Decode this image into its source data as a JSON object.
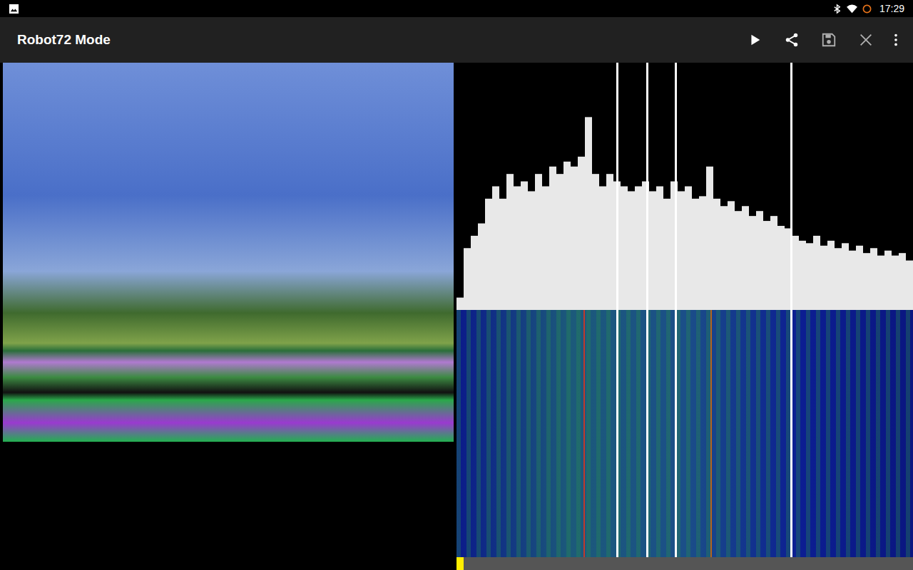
{
  "status_bar": {
    "time": "17:29"
  },
  "app_bar": {
    "title": "Robot72 Mode",
    "actions": [
      {
        "kind": "play",
        "disabled": false
      },
      {
        "kind": "share",
        "disabled": false
      },
      {
        "kind": "save",
        "disabled": true
      },
      {
        "kind": "close",
        "disabled": true
      },
      {
        "kind": "more",
        "disabled": false
      }
    ]
  },
  "spectrum": {
    "bins": 64,
    "values": [
      0.05,
      0.25,
      0.3,
      0.35,
      0.45,
      0.5,
      0.45,
      0.55,
      0.5,
      0.52,
      0.48,
      0.55,
      0.5,
      0.58,
      0.55,
      0.6,
      0.58,
      0.62,
      0.78,
      0.55,
      0.5,
      0.55,
      0.52,
      0.5,
      0.48,
      0.5,
      0.52,
      0.48,
      0.5,
      0.45,
      0.52,
      0.48,
      0.5,
      0.45,
      0.46,
      0.58,
      0.45,
      0.42,
      0.44,
      0.4,
      0.42,
      0.38,
      0.4,
      0.36,
      0.38,
      0.34,
      0.33,
      0.3,
      0.28,
      0.27,
      0.3,
      0.26,
      0.28,
      0.25,
      0.27,
      0.24,
      0.26,
      0.23,
      0.25,
      0.22,
      0.24,
      0.22,
      0.23,
      0.2
    ],
    "markers": [
      22.4,
      26.6,
      30.6,
      46.8
    ]
  },
  "waterfall": {
    "traces": [
      {
        "bin": 17.8,
        "color": "#c0392b"
      },
      {
        "bin": 35.6,
        "color": "#b5651d"
      }
    ]
  },
  "progress": {
    "level": 0.016
  }
}
